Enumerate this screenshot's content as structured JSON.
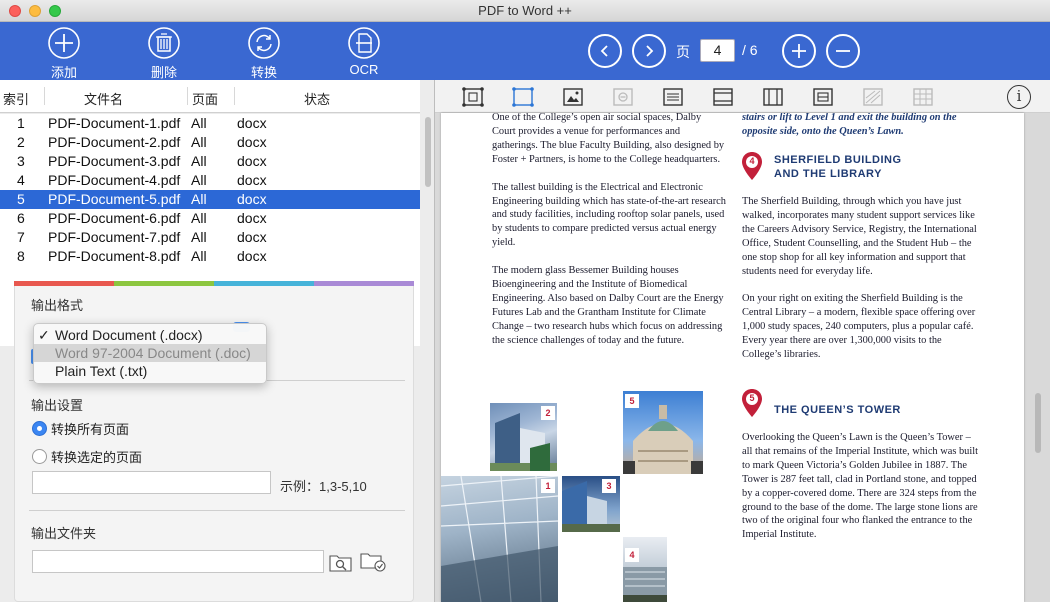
{
  "window": {
    "title": "PDF to Word ++"
  },
  "toolbar": {
    "add_label": "添加",
    "delete_label": "删除",
    "convert_label": "转换",
    "ocr_label": "OCR",
    "page_label": "页",
    "current_page": "4",
    "total_pages": "/ 6"
  },
  "file_table": {
    "headers": {
      "index": "索引",
      "filename": "文件名",
      "pages": "页面",
      "status": "状态"
    },
    "rows": [
      {
        "index": "1",
        "name": "PDF-Document-1.pdf",
        "pages": "All",
        "status": "docx"
      },
      {
        "index": "2",
        "name": "PDF-Document-2.pdf",
        "pages": "All",
        "status": "docx"
      },
      {
        "index": "3",
        "name": "PDF-Document-3.pdf",
        "pages": "All",
        "status": "docx"
      },
      {
        "index": "4",
        "name": "PDF-Document-4.pdf",
        "pages": "All",
        "status": "docx"
      },
      {
        "index": "5",
        "name": "PDF-Document-5.pdf",
        "pages": "All",
        "status": "docx"
      },
      {
        "index": "6",
        "name": "PDF-Document-6.pdf",
        "pages": "All",
        "status": "docx"
      },
      {
        "index": "7",
        "name": "PDF-Document-7.pdf",
        "pages": "All",
        "status": "docx"
      },
      {
        "index": "8",
        "name": "PDF-Document-8.pdf",
        "pages": "All",
        "status": "docx"
      }
    ],
    "selected_index": "5"
  },
  "settings": {
    "output_format_title": "输出格式",
    "format_options": [
      "Word Document (.docx)",
      "Word 97-2004 Document (.doc)",
      "Plain Text (.txt)"
    ],
    "selected_format": "Word Document (.docx)",
    "check_mark": "✓",
    "output_settings_title": "输出设置",
    "radio_all_pages": "转换所有页面",
    "radio_selected_pages": "转换选定的页面",
    "page_range_value": "",
    "example_hint": "示例：1,3-5,10",
    "output_folder_title": "输出文件夹",
    "output_folder_value": ""
  },
  "colors": {
    "toolbar": "#3a68d1",
    "selection": "#2c68d6",
    "accent_bar": [
      "#e8584f",
      "#8cc63f",
      "#46b3d9",
      "#a98ad6"
    ],
    "doc_heading": "#1f3b73",
    "doc_pin": "#c2203a"
  },
  "view_toolbar": {
    "info_label": "i",
    "icons": [
      "select-region-icon",
      "crop-region-icon",
      "image-region-icon",
      "remove-region-icon",
      "text-region-icon",
      "horizontal-split-icon",
      "vertical-split-icon",
      "table-region-icon",
      "column-region-icon",
      "grid-region-icon"
    ]
  },
  "document": {
    "col1": [
      "One of the College’s open air social spaces, Dalby Court provides a venue for performances and gatherings. The blue Faculty Building, also designed by Foster + Partners, is home to the College headquarters.",
      "The tallest building is the Electrical and Electronic Engineering building which has state-of-the-art research and study facilities, including rooftop solar panels, used by students to compare predicted versus actual energy yield.",
      "The modern glass Bessemer Building houses Bioengineering and the Institute of Biomedical Engineering. Also based on Dalby Court are the Energy Futures Lab and the Grantham Institute for Climate Change – two research hubs which focus on addressing the science challenges of today and the future."
    ],
    "col2_intro": "stairs or lift to Level 1 and exit the building on the opposite side, onto the Queen’s Lawn.",
    "pin4": "4",
    "heading4_line1": "SHERFIELD BUILDING",
    "heading4_line2": "AND THE LIBRARY",
    "col2_p1": "The Sherfield Building, through which you have just walked, incorporates many student support services like the Careers Advisory Service, Registry, the International Office, Student Counselling, and the Student Hub – the one stop shop for all key information and support that students need for everyday life.",
    "col2_p2": "On your right on exiting the Sherfield Building is the Central Library – a modern, flexible space offering over 1,000 study spaces, 240 computers, plus a popular café. Every year there are over 1,300,000 visits to the College’s libraries.",
    "pin5": "5",
    "heading5": "THE QUEEN’S TOWER",
    "col2_p3": "Overlooking the Queen’s Lawn is the Queen’s Tower – all that remains of the Imperial Institute, which was built to mark Queen Victoria’s Golden Jubilee in 1887. The Tower is 287 feet tall, clad in Portland stone, and topped by a copper-covered dome. There are 324 steps from the ground to the base of the dome. The large stone lions are two of the original four who flanked the entrance to the Imperial Institute.",
    "photo_labels": [
      "2",
      "5",
      "1",
      "3",
      "4"
    ]
  }
}
